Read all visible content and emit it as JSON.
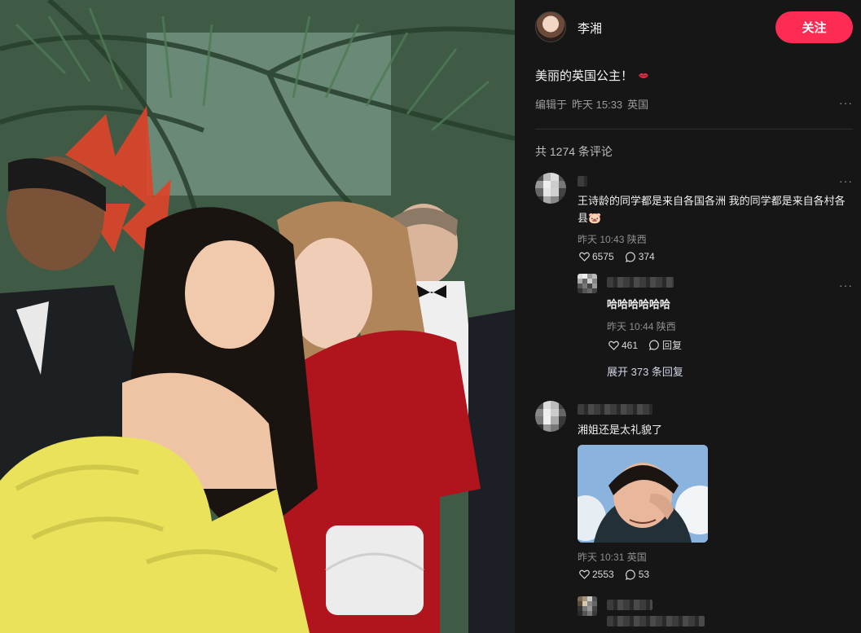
{
  "post": {
    "author": "李湘",
    "follow_label": "关注",
    "caption": "美丽的英国公主！",
    "edited_prefix": "编辑于",
    "time": "昨天 15:33",
    "location": "英国",
    "more": "···"
  },
  "comments": {
    "count_text": "共 1274 条评论",
    "items": [
      {
        "text": "王诗龄的同学都是来自各国各洲 我的同学都是来自各村各县🐷",
        "time": "昨天 10:43",
        "location": "陕西",
        "likes": "6575",
        "replies": "374",
        "reply": {
          "text": "哈哈哈哈哈哈",
          "time": "昨天 10:44",
          "location": "陕西",
          "likes": "461",
          "reply_label": "回复"
        },
        "expand_label": "展开 373 条回复"
      },
      {
        "text": "湘姐还是太礼貌了",
        "time": "昨天 10:31",
        "location": "英国",
        "likes": "2553",
        "replies": "53"
      }
    ]
  },
  "colors": {
    "accent": "#fe2c55",
    "panel_bg": "#161616"
  },
  "icons": [
    "lips-icon",
    "heart-icon",
    "comment-icon",
    "more-icon"
  ]
}
